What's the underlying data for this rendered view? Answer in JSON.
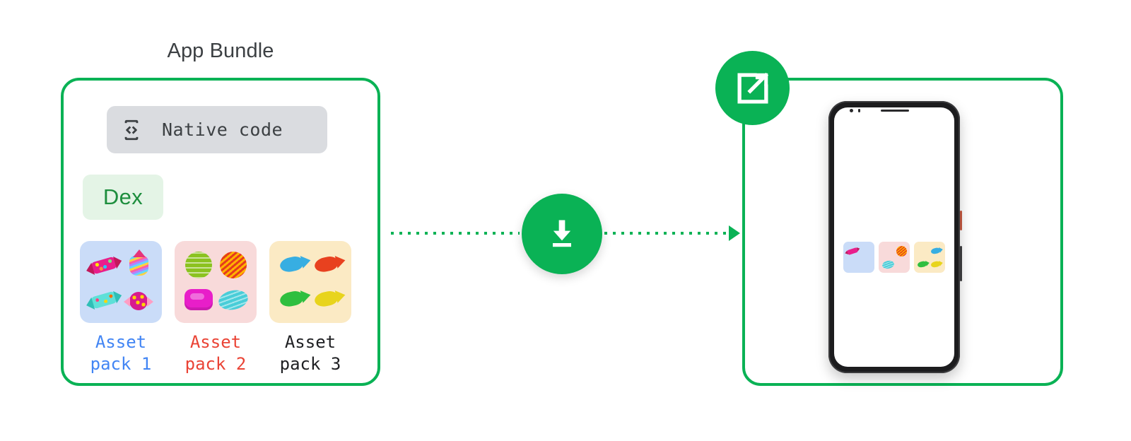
{
  "diagram": {
    "accent_green": "#0ab255",
    "background": "#ffffff"
  },
  "bundle": {
    "title": "App Bundle",
    "native_code": {
      "label": "Native code",
      "icon": "device-code-icon",
      "chip_bg": "#dadce0",
      "text_color": "#3c4043"
    },
    "dex": {
      "label": "Dex",
      "chip_bg": "#e4f4e6",
      "text_color": "#1e8e3e"
    },
    "asset_packs": [
      {
        "label": "Asset\npack 1",
        "label_color": "#4285f4",
        "thumb_bg": "#cadcf8",
        "thumb_art": "candies"
      },
      {
        "label": "Asset\npack 2",
        "label_color": "#ea4335",
        "thumb_bg": "#f8dada",
        "thumb_art": "jellies"
      },
      {
        "label": "Asset\npack 3",
        "label_color": "#202124",
        "thumb_bg": "#fbeac4",
        "thumb_art": "fish"
      }
    ]
  },
  "flow": {
    "download_node_icon": "download-icon",
    "download_node_color": "#0ab255",
    "connector_style": "dotted",
    "connector_color": "#0ab255",
    "arrow_direction": "right"
  },
  "device": {
    "external_badge_icon": "external-link-icon",
    "external_badge_color": "#0ab255",
    "phone_frame_color": "#1c1c1e",
    "screen_color": "#ffffff",
    "installed_tiles": [
      {
        "bg": "#cadcf8",
        "art": "candy-mini"
      },
      {
        "bg": "#f8dada",
        "art": "jelly-mini"
      },
      {
        "bg": "#fbeac4",
        "art": "fish-mini"
      }
    ]
  }
}
